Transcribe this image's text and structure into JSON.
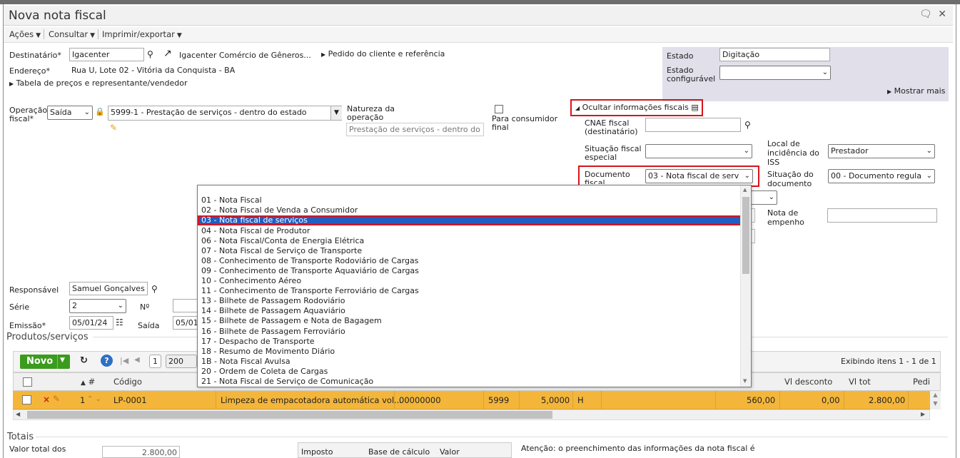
{
  "window": {
    "title": "Nova nota fiscal"
  },
  "menu": {
    "acoes": "Ações",
    "consultar": "Consultar",
    "imprimir": "Imprimir/exportar"
  },
  "header": {
    "destinatario_label": "Destinatário*",
    "destinatario_value": "Igacenter",
    "destinatario_name": "Igacenter Comércio de Gêneros...",
    "pedido_link": "Pedido do cliente e referência",
    "endereco_label": "Endereço*",
    "endereco_value": "Rua U, Lote 02 - Vitória da Conquista - BA",
    "tabela_link": "Tabela de preços e representante/vendedor"
  },
  "status_panel": {
    "estado_label": "Estado",
    "estado_value": "Digitação",
    "estado_conf_label1": "Estado",
    "estado_conf_label2": "configurável",
    "estado_conf_value": "",
    "mostrar_mais": "Mostrar mais"
  },
  "operacao": {
    "label1": "Operação",
    "label2": "fiscal*",
    "tipo": "Saída",
    "cfop": "5999-1 - Prestação de serviços - dentro do estado",
    "natureza_label1": "Natureza da",
    "natureza_label2": "operação",
    "natureza_value": "Prestação de serviços - dentro do e",
    "consumidor_label1": "Para consumidor",
    "consumidor_label2": "final"
  },
  "fiscal": {
    "ocultar": "Ocultar informações fiscais",
    "cnae_label1": "CNAE fiscal",
    "cnae_label2": "(destinatário)",
    "situacao_especial_label1": "Situação fiscal",
    "situacao_especial_label2": "especial",
    "local_iss_label1": "Local de",
    "local_iss_label2": "incidência do",
    "local_iss_label3": "ISS",
    "local_iss_value": "Prestador",
    "documento_label1": "Documento",
    "documento_label2": "fiscal",
    "documento_value": "03 - Nota fiscal de serv",
    "situacao_doc_label1": "Situação do",
    "situacao_doc_label2": "documento",
    "situacao_doc_value": "00 - Documento regula",
    "nota_empenho_label1": "Nota de",
    "nota_empenho_label2": "empenho"
  },
  "left_fields": {
    "responsavel_label": "Responsável",
    "responsavel_value": "Samuel Gonçalves",
    "serie_label": "Série",
    "serie_value": "2",
    "numero_label": "Nº",
    "emissao_label": "Emissão*",
    "emissao_value": "05/01/24",
    "saida_label": "Saída",
    "saida_value": "05/01"
  },
  "dropdown_options": [
    "01 - Nota Fiscal",
    "02 - Nota Fiscal de Venda a Consumidor",
    "03 - Nota fiscal de serviços",
    "04 - Nota Fiscal de Produtor",
    "06 - Nota Fiscal/Conta de Energia Elétrica",
    "07 - Nota Fiscal de Serviço de Transporte",
    "08 - Conhecimento de Transporte Rodoviário de Cargas",
    "09 - Conhecimento de Transporte Aquaviário de Cargas",
    "10 - Conhecimento Aéreo",
    "11 - Conhecimento de Transporte Ferroviário de Cargas",
    "13 - Bilhete de Passagem Rodoviário",
    "14 - Bilhete de Passagem Aquaviário",
    "15 - Bilhete de Passagem e Nota de Bagagem",
    "16 - Bilhete de Passagem Ferroviário",
    "17 - Despacho de Transporte",
    "18 - Resumo de Movimento Diário",
    "1B - Nota Fiscal Avulsa",
    "20 - Ordem de Coleta de Cargas",
    "21 - Nota Fiscal de Serviço de Comunicação"
  ],
  "produtos": {
    "title": "Produtos/serviços",
    "novo": "Novo",
    "page": "1",
    "page_size": "200",
    "exibindo": "Exibindo itens 1 - 1 de 1",
    "col_num": "#",
    "col_codigo": "Código",
    "col_desconto": "Vl desconto",
    "col_total": "Vl tot",
    "col_pedido": "Pedi",
    "row": {
      "num": "1",
      "codigo": "LP-0001",
      "descricao": "Limpeza de empacotadora automática vol...",
      "ncm": "00000000",
      "cfop": "5999",
      "qtd": "5,0000",
      "unidade": "H",
      "valor": "560,00",
      "desconto": "0,00",
      "total": "2.800,00"
    }
  },
  "totais": {
    "title": "Totais",
    "valor_total_label": "Valor total dos",
    "valor_total_value": "2.800,00",
    "col_imposto": "Imposto",
    "col_base": "Base de cálculo",
    "col_valor": "Valor",
    "atencao": "Atenção: o preenchimento das informações da nota fiscal é"
  }
}
